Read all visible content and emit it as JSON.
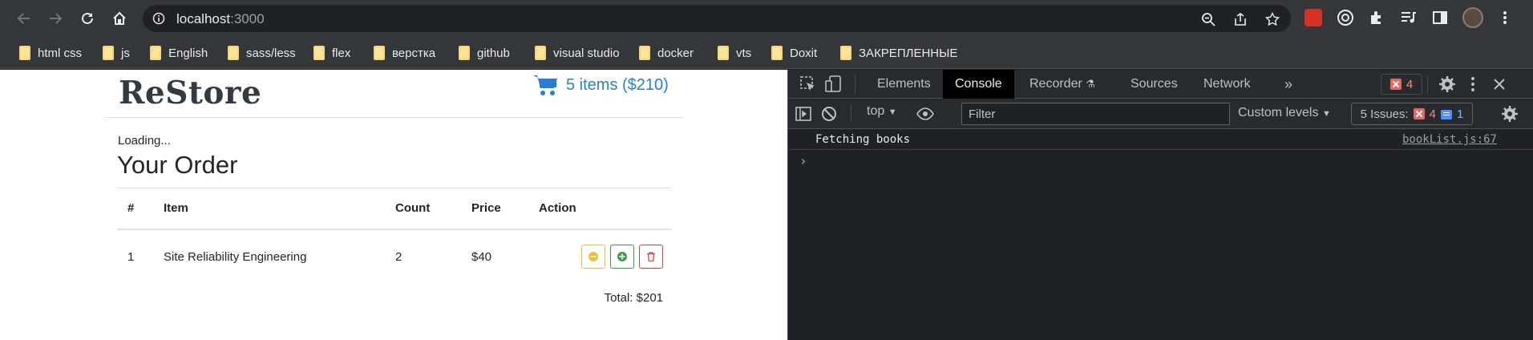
{
  "browser": {
    "url_host": "localhost",
    "url_port": ":3000",
    "bookmarks": [
      "html css",
      "js",
      "English",
      "sass/less",
      "flex",
      "верстка",
      "github",
      "visual studio",
      "docker",
      "vts",
      "Doxit",
      "ЗАКРЕПЛЕННЫЕ"
    ]
  },
  "site": {
    "brand": "ReStore",
    "cart_label": "5 items ($210)",
    "loading": "Loading...",
    "order_title": "Your Order",
    "table": {
      "headers": [
        "#",
        "Item",
        "Count",
        "Price",
        "Action"
      ],
      "rows": [
        {
          "num": "1",
          "item": "Site Reliability Engineering",
          "count": "2",
          "price": "$40"
        }
      ]
    },
    "total": "Total: $201"
  },
  "devtools": {
    "tabs": [
      "Elements",
      "Console",
      "Recorder",
      "Sources",
      "Network"
    ],
    "active_tab": "Console",
    "more_tabs": "»",
    "error_count": "4",
    "context": "top",
    "filter_placeholder": "Filter",
    "levels": "Custom levels",
    "issues_label": "5 Issues:",
    "issues_errors": "4",
    "issues_info": "1",
    "log_message": "Fetching books",
    "log_source": "bookList.js:67",
    "prompt": "›"
  },
  "colors": {
    "accent": "#2a7ed1",
    "devtools_bg": "#202124",
    "chrome_bg": "#35363a"
  }
}
